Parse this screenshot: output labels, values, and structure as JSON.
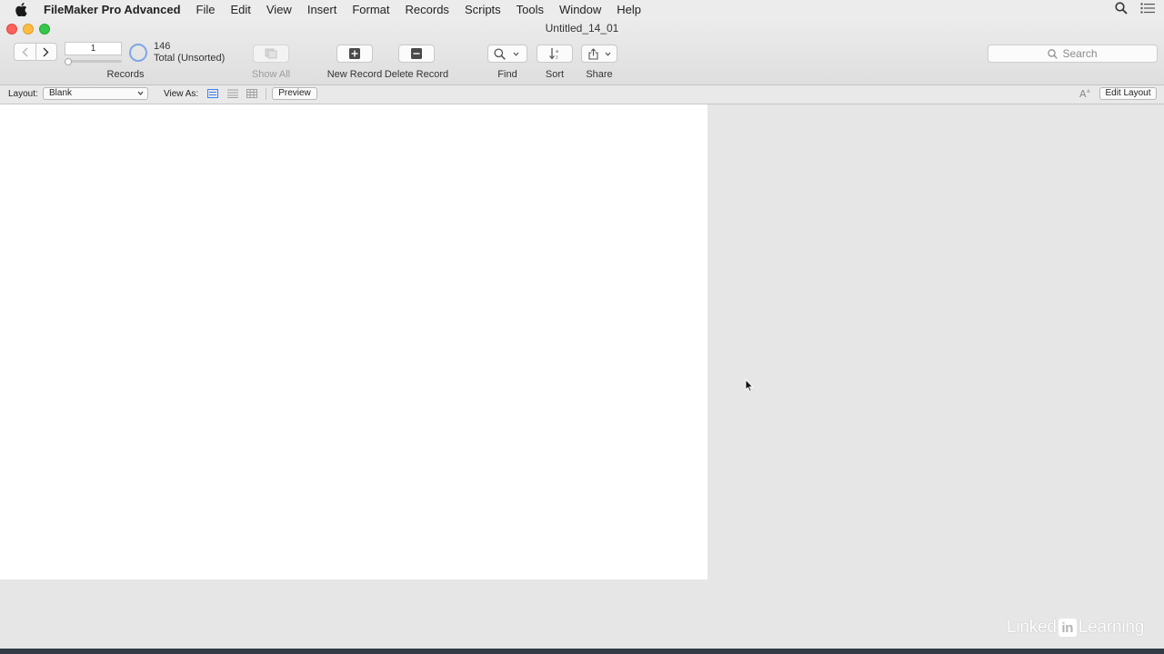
{
  "menubar": {
    "app_name": "FileMaker Pro Advanced",
    "items": [
      "File",
      "Edit",
      "View",
      "Insert",
      "Format",
      "Records",
      "Scripts",
      "Tools",
      "Window",
      "Help"
    ],
    "icons": [
      "apple-icon",
      "spotlight-search-icon",
      "notification-list-icon"
    ]
  },
  "window": {
    "title": "Untitled_14_01"
  },
  "toolbar": {
    "record_number": "1",
    "records_label": "Records",
    "found_count": "146",
    "total_label": "Total (Unsorted)",
    "show_all_label": "Show All",
    "new_record_label": "New Record",
    "delete_record_label": "Delete Record",
    "find_label": "Find",
    "sort_label": "Sort",
    "share_label": "Share",
    "search_placeholder": "Search"
  },
  "layout_bar": {
    "layout_label": "Layout:",
    "layout_value": "Blank",
    "view_as_label": "View As:",
    "view_modes": [
      "form",
      "list",
      "table"
    ],
    "active_view": "form",
    "preview_label": "Preview",
    "edit_layout_label": "Edit Layout"
  },
  "watermark": {
    "left": "Linked",
    "in": "in",
    "right": "Learning"
  },
  "colors": {
    "accent": "#3b82f6",
    "canvas": "#ffffff",
    "background": "#e6e6e6"
  }
}
